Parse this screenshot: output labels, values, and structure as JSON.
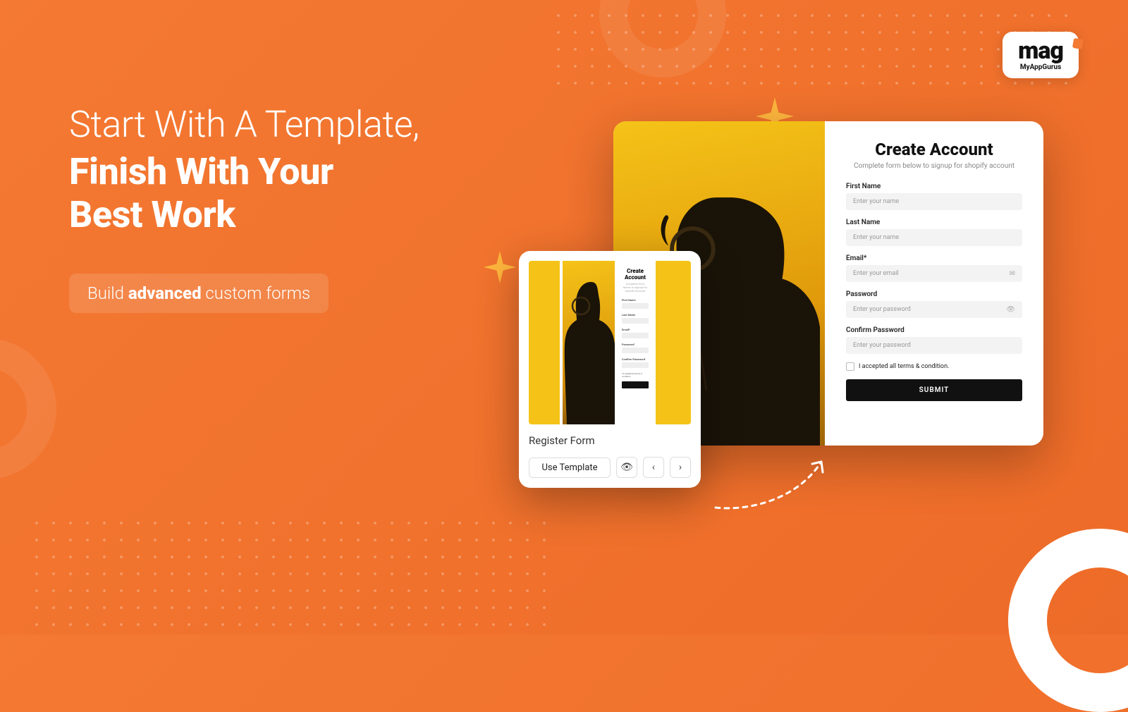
{
  "brand": {
    "name": "mag",
    "subtitle": "MyAppGurus"
  },
  "headline": {
    "line1": "Start With A Template,",
    "line2": "Finish With Your",
    "line3": "Best Work"
  },
  "pill": {
    "prefix": "Build ",
    "strong": "advanced",
    "suffix": " custom forms"
  },
  "large_form": {
    "title": "Create Account",
    "subtitle": "Complete form below to signup for shopify account",
    "fields": {
      "first_name": {
        "label": "First Name",
        "placeholder": "Enter your name"
      },
      "last_name": {
        "label": "Last Name",
        "placeholder": "Enter your name"
      },
      "email": {
        "label": "Email*",
        "placeholder": "Enter your email"
      },
      "password": {
        "label": "Password",
        "placeholder": "Enter your password"
      },
      "confirm": {
        "label": "Confirm Password",
        "placeholder": "Enter your password"
      }
    },
    "terms": "I accepted all terms & condition.",
    "submit": "SUBMIT"
  },
  "small_card": {
    "title": "Register Form",
    "use_button": "Use Template",
    "mini": {
      "title": "Create Account",
      "subtitle": "Complete form below to signup for shopify account",
      "labels": {
        "fn": "First Name",
        "ln": "Last Name",
        "em": "Email*",
        "pw": "Password",
        "cp": "Confirm Password"
      },
      "chk": "I accepted all terms & condition."
    }
  }
}
